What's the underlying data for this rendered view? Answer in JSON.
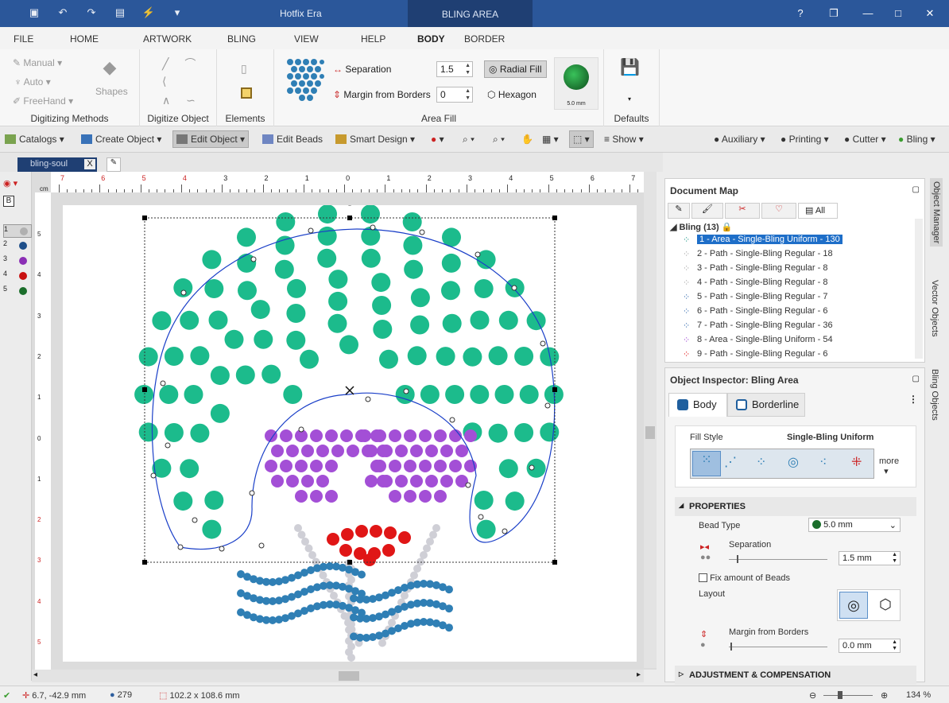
{
  "app": {
    "title": "Hotfix Era",
    "context_tab": "BLING AREA"
  },
  "window": {
    "minimize": "—",
    "restore": "❐",
    "maximize": "□",
    "close": "✕",
    "help": "?"
  },
  "ribbon_tabs": [
    "FILE",
    "HOME",
    "ARTWORK",
    "BLING",
    "VIEW",
    "HELP",
    "BODY",
    "BORDER"
  ],
  "active_tab": "BODY",
  "ribbon": {
    "digitizing_methods": {
      "label": "Digitizing Methods",
      "manual": "Manual",
      "auto": "Auto",
      "freehand": "FreeHand",
      "shapes": "Shapes"
    },
    "digitize_object": {
      "label": "Digitize Object"
    },
    "elements": {
      "label": "Elements"
    },
    "area_fill": {
      "label": "Area Fill",
      "separation_label": "Separation",
      "separation_value": "1.5",
      "margin_label": "Margin from Borders",
      "margin_value": "0",
      "radial_fill": "Radial Fill",
      "hexagon": "Hexagon",
      "bead_size": "5.0 mm"
    },
    "defaults": {
      "label": "Defaults"
    }
  },
  "toolbar": {
    "catalogs": "Catalogs",
    "create_object": "Create Object",
    "edit_object": "Edit Object",
    "edit_beads": "Edit Beads",
    "smart_design": "Smart Design",
    "show": "Show",
    "auxiliary": "Auxiliary",
    "printing": "Printing",
    "cutter": "Cutter",
    "bling": "Bling"
  },
  "document_tab": {
    "name": "bling-soul",
    "close": "X"
  },
  "left_toolbar": {
    "b_label": "B",
    "color_rows": [
      {
        "num": "1",
        "color": "#b0b0b0"
      },
      {
        "num": "2",
        "color": "#1f4f8a"
      },
      {
        "num": "3",
        "color": "#8b2fb5"
      },
      {
        "num": "4",
        "color": "#c81010"
      },
      {
        "num": "5",
        "color": "#1b6e2b"
      }
    ]
  },
  "ruler": {
    "unit": "cm",
    "h_ticks": [
      "7",
      "6",
      "5",
      "4",
      "3",
      "2",
      "1",
      "0",
      "1",
      "2",
      "3",
      "4",
      "5",
      "6",
      "7"
    ],
    "v_ticks": [
      "5",
      "4",
      "3",
      "2",
      "1",
      "0",
      "1",
      "2",
      "3",
      "4",
      "5"
    ]
  },
  "design": {
    "area_color": "#1cbb8c",
    "purple": "#a34fd6",
    "red": "#e01616",
    "blue": "#2f7fb5",
    "grey": "#cfcfd6",
    "outline": "#1a3fc8"
  },
  "document_map": {
    "title": "Document Map",
    "all_tab": "All",
    "group": "Bling (13)",
    "items": [
      {
        "label": "1 - Area - Single-Bling Uniform - 130",
        "color": "#2a9d8f"
      },
      {
        "label": "2 - Path - Single-Bling Regular - 18",
        "color": "#aaaaaa"
      },
      {
        "label": "3 - Path - Single-Bling Regular - 8",
        "color": "#aaaaaa"
      },
      {
        "label": "4 - Path - Single-Bling Regular - 8",
        "color": "#aaaaaa"
      },
      {
        "label": "5 - Path - Single-Bling Regular - 7",
        "color": "#3a6fb0"
      },
      {
        "label": "6 - Path - Single-Bling Regular - 6",
        "color": "#3a6fb0"
      },
      {
        "label": "7 - Path - Single-Bling Regular - 36",
        "color": "#3a6fb0"
      },
      {
        "label": "8 - Area - Single-Bling Uniform - 54",
        "color": "#a34fd6"
      },
      {
        "label": "9 - Path - Single-Bling Regular - 6",
        "color": "#e01616"
      }
    ]
  },
  "inspector": {
    "title": "Object Inspector: Bling Area",
    "tab_body": "Body",
    "tab_borderline": "Borderline",
    "fill_style_label": "Fill Style",
    "fill_style_value": "Single-Bling Uniform",
    "more": "more",
    "properties": "PROPERTIES",
    "bead_type_label": "Bead Type",
    "bead_type_value": "5.0 mm",
    "separation_label": "Separation",
    "separation_value": "1.5 mm",
    "fix_beads": "Fix amount of Beads",
    "layout": "Layout",
    "margin_label": "Margin from Borders",
    "margin_value": "0.0 mm",
    "adjustment": "ADJUSTMENT & COMPENSATION"
  },
  "side_tabs": [
    "Object Manager",
    "Vector Objects",
    "Bling Objects"
  ],
  "status": {
    "coords": "6.7, -42.9 mm",
    "count": "279",
    "size": "102.2 x 108.6 mm",
    "zoom": "134 %"
  }
}
